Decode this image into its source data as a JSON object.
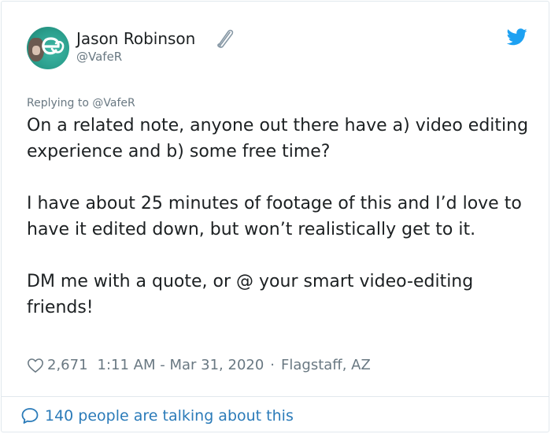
{
  "author": {
    "name": "Jason Robinson",
    "handle": "@VafeR",
    "avatar_icon": "avatar-ae-logo",
    "badge_icon": "safety-pin-icon"
  },
  "brand": {
    "icon": "twitter-bird-icon",
    "color": "#1da1f2"
  },
  "tweet": {
    "replying_to": "Replying to @VafeR",
    "paragraphs": [
      "On a related note, anyone out there have a) video editing experience and b) some free time?",
      "I have about 25 minutes of footage of this and I’d love to have it edited down, but won’t realistically get to it.",
      "DM me with a quote, or @ your smart video-editing friends!"
    ]
  },
  "meta": {
    "likes": "2,671",
    "timestamp": "1:11 AM - Mar 31, 2020",
    "separator": "·",
    "location": "Flagstaff, AZ"
  },
  "footer": {
    "talking_text": "140 people are talking about this",
    "link_color": "#2b7bb9"
  }
}
